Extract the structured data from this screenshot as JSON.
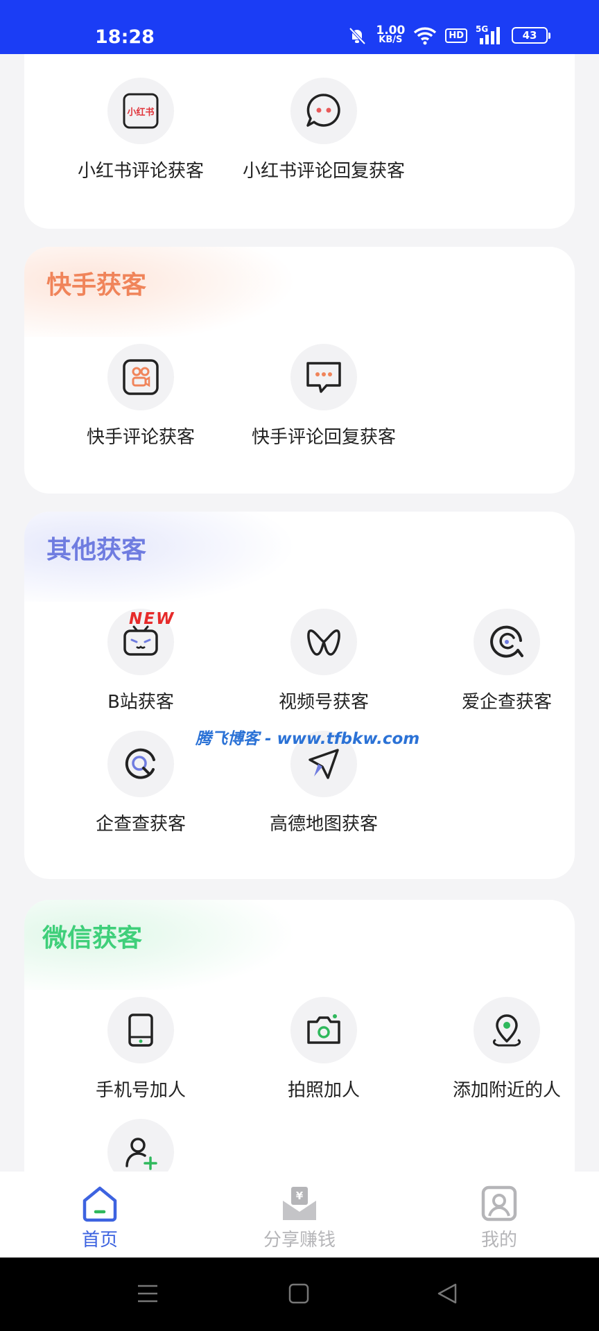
{
  "status_bar": {
    "time": "18:28",
    "net_speed": "1.00",
    "net_unit": "KB/S",
    "hd": "HD",
    "network": "5G",
    "battery": "43"
  },
  "top_card": {
    "items": [
      {
        "label": "小红书评论获客",
        "icon_text": "小红书"
      },
      {
        "label": "小红书评论回复获客"
      }
    ]
  },
  "kuaishou": {
    "title": "快手获客",
    "title_color": "#f0845a",
    "items": [
      {
        "label": "快手评论获客"
      },
      {
        "label": "快手评论回复获客"
      }
    ]
  },
  "other": {
    "title": "其他获客",
    "title_color": "#6f7ce0",
    "badge": "NEW",
    "items": [
      {
        "label": "B站获客"
      },
      {
        "label": "视频号获客"
      },
      {
        "label": "爱企查获客"
      },
      {
        "label": "企查查获客"
      },
      {
        "label": "高德地图获客"
      }
    ]
  },
  "wechat": {
    "title": "微信获客",
    "title_color": "#3fcf7a",
    "items": [
      {
        "label": "手机号加人"
      },
      {
        "label": "拍照加人"
      },
      {
        "label": "添加附近的人"
      }
    ]
  },
  "watermark": "腾飞博客 - www.tfbkw.com",
  "bottom_nav": {
    "items": [
      {
        "label": "首页",
        "active": true
      },
      {
        "label": "分享赚钱",
        "active": false
      },
      {
        "label": "我的",
        "active": false
      }
    ]
  },
  "colors": {
    "status_bar": "#1b3df5",
    "accent": "#3d63e0",
    "icon_green": "#2fb85c"
  }
}
